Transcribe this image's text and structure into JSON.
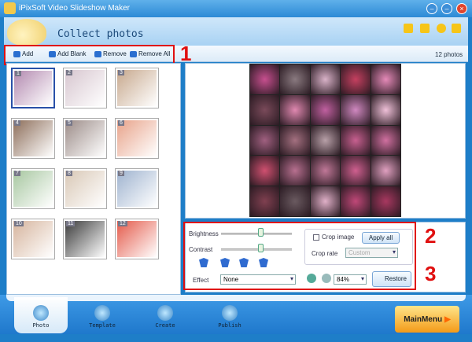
{
  "window": {
    "title": "iPixSoft Video Slideshow Maker",
    "minimize": "–",
    "restore": "–",
    "close": "×"
  },
  "header": {
    "title": "Collect photos"
  },
  "toolbar": {
    "add": "Add",
    "add_blank": "Add Blank",
    "remove": "Remove",
    "remove_all": "Remove All",
    "count": "12 photos"
  },
  "annotations": {
    "one": "1",
    "two": "2",
    "three": "3"
  },
  "thumbnails": [
    {
      "n": "1",
      "color": "#b38ab0"
    },
    {
      "n": "2",
      "color": "#d7c6cf"
    },
    {
      "n": "3",
      "color": "#c7a88d"
    },
    {
      "n": "4",
      "color": "#8d6e5a"
    },
    {
      "n": "5",
      "color": "#9c8c88"
    },
    {
      "n": "6",
      "color": "#e8a38a"
    },
    {
      "n": "7",
      "color": "#a7c7a0"
    },
    {
      "n": "8",
      "color": "#d9c8b6"
    },
    {
      "n": "9",
      "color": "#9fb3cf"
    },
    {
      "n": "10",
      "color": "#d6b49d"
    },
    {
      "n": "11",
      "color": "#3b3b3b"
    },
    {
      "n": "12",
      "color": "#e45a4a"
    }
  ],
  "collage_colors": [
    "#c74f8f",
    "#8a7a80",
    "#d9b2c8",
    "#c54060",
    "#e58ab8",
    "#7a4a5a",
    "#e088b0",
    "#c060a0",
    "#d088c0",
    "#efc0d8",
    "#a06080",
    "#a47080",
    "#b8a0a8",
    "#c86090",
    "#d070a0",
    "#d05070",
    "#b87090",
    "#c07898",
    "#d06090",
    "#e0a0c0",
    "#804050",
    "#6a5a60",
    "#e0b0c8",
    "#c04878",
    "#a83860"
  ],
  "controls": {
    "brightness_label": "Brightness",
    "brightness_value": 0.55,
    "contrast_label": "Contrast",
    "contrast_value": 0.55,
    "effect_label": "Effect",
    "effect_value": "None",
    "crop_image_label": "Crop image",
    "crop_image_checked": false,
    "apply_all": "Apply all",
    "crop_rate_label": "Crop rate",
    "crop_rate_value": "Custom",
    "zoom_value": "84%",
    "restore": "Restore"
  },
  "nav": {
    "photo": "Photo",
    "template": "Template",
    "create": "Create",
    "publish": "Publish",
    "main_menu": "MainMenu"
  }
}
